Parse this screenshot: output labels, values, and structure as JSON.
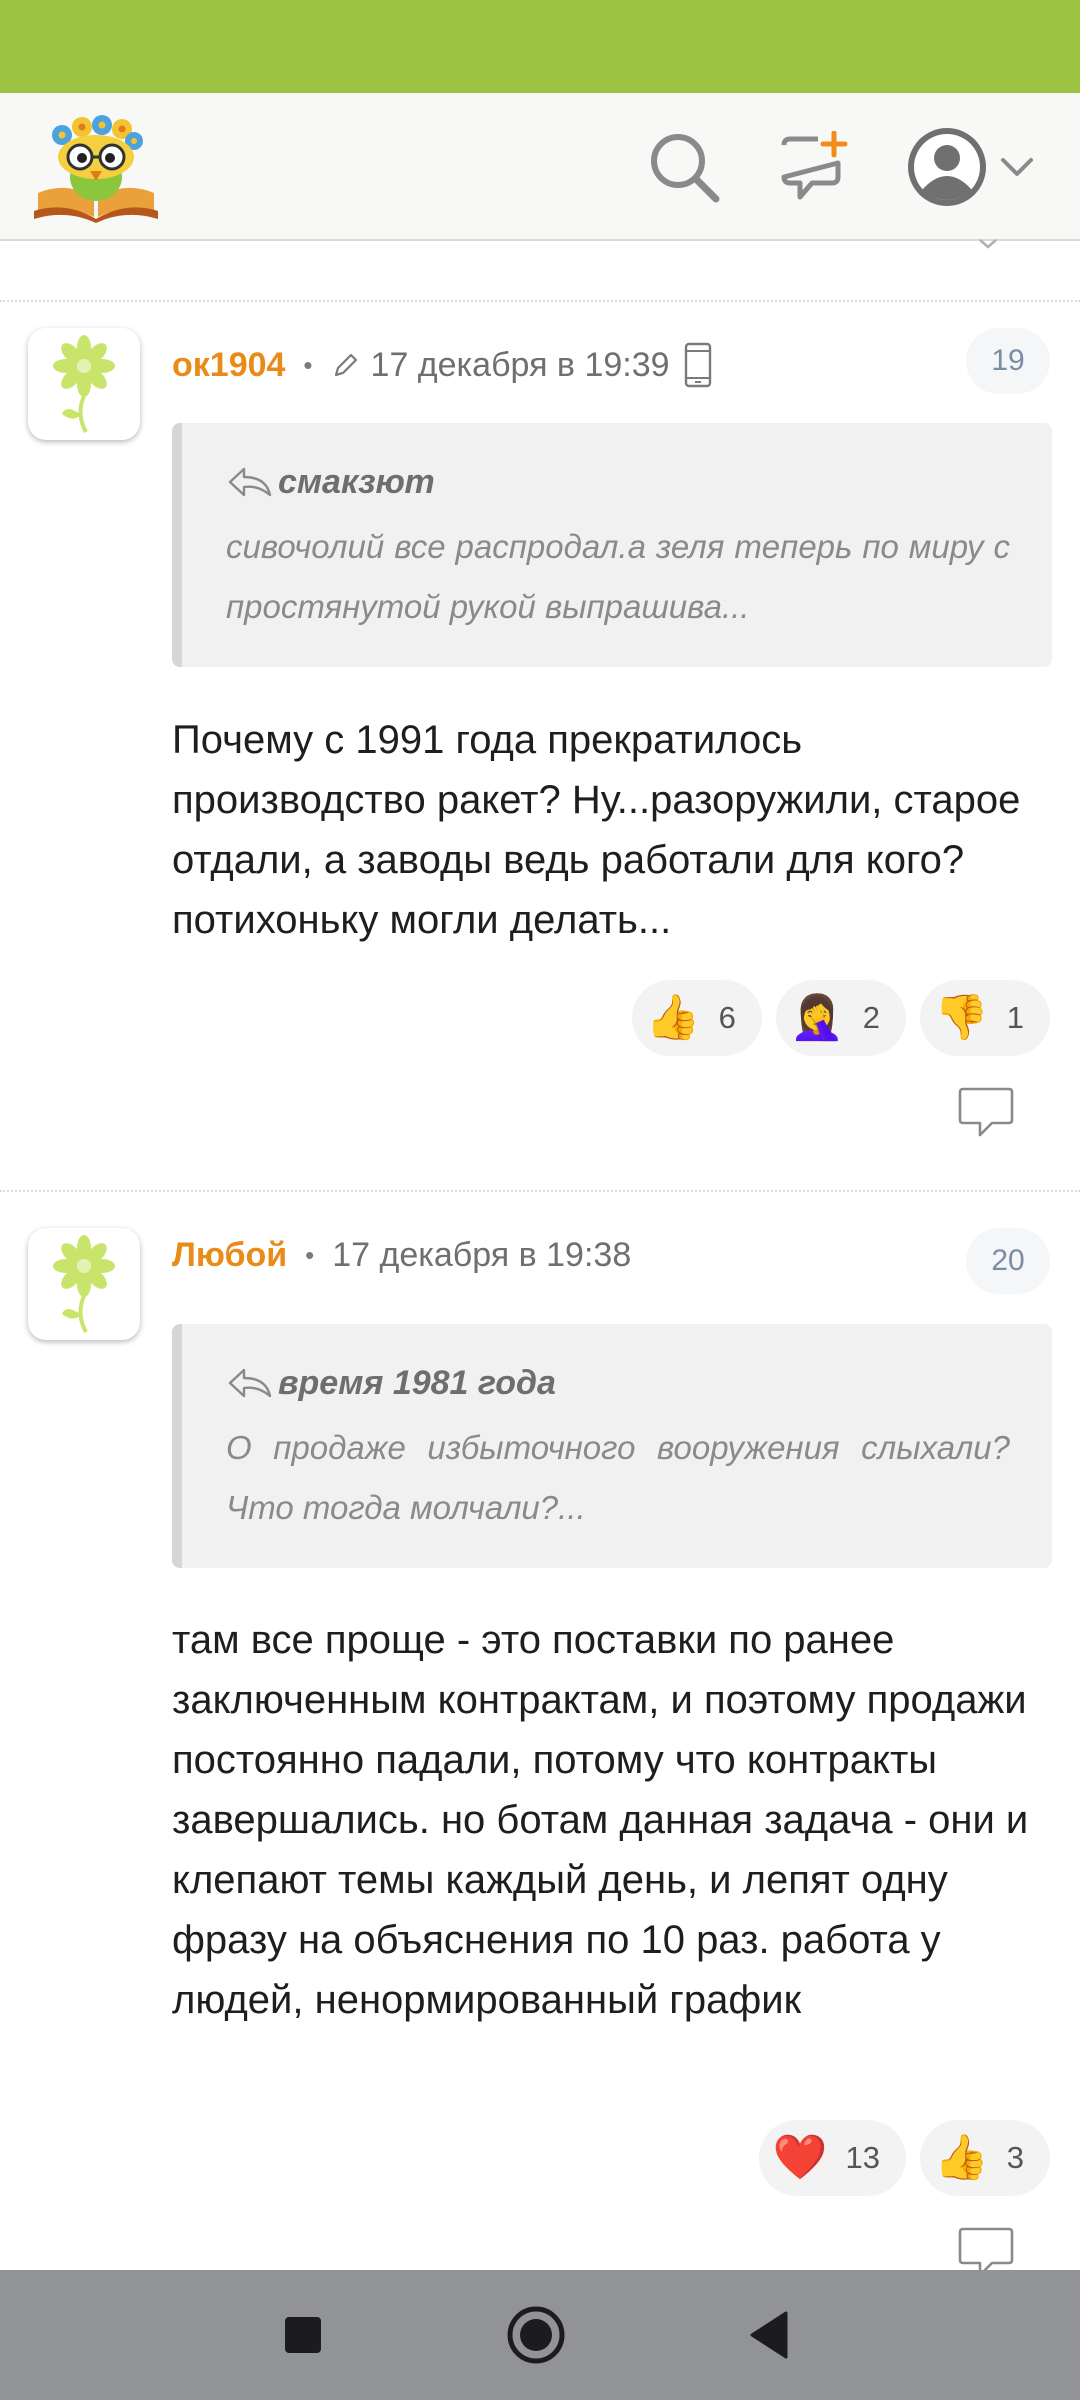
{
  "header": {
    "logo_icon": "flower-owl-book-logo",
    "search_icon": "search-icon",
    "new_post_icon": "new-post-icon",
    "user_icon": "user-avatar-icon",
    "menu_icon": "chevron-down-icon"
  },
  "colors": {
    "status_bar": "#9dc342",
    "author": "#e98a19",
    "badge_text": "#7a8ca6"
  },
  "comments": [
    {
      "author": "ок1904",
      "separator": "•",
      "date": "17 декабря в 19:39",
      "edited": true,
      "from_mobile": true,
      "number": "19",
      "quote": {
        "author": "смакзют",
        "text": "сивочолий все распродал.а зеля теперь по миру с простянутой рукой выпрашива..."
      },
      "text": "Почему с 1991 года прекратилось производство ракет? Ну...разоружили, старое отдали, а заводы ведь работали для кого? потихоньку могли делать...",
      "reactions": [
        {
          "emoji": "👍",
          "count": "6"
        },
        {
          "emoji": "🤦‍♀️",
          "count": "2"
        },
        {
          "emoji": "👎",
          "count": "1"
        }
      ]
    },
    {
      "author": "Любой",
      "separator": "•",
      "date": "17 декабря в 19:38",
      "edited": false,
      "from_mobile": false,
      "number": "20",
      "quote": {
        "author": "время 1981 года",
        "text": "О продаже избыточного вооружения слыхали? Что тогда молчали?..."
      },
      "text": "там все проще - это поставки по ранее заключенным контрактам, и поэтому продажи постоянно падали, потому что контракты завершались. но ботам данная задача - они и клепают темы каждый день, и лепят одну фразу на объяснения по 10 раз. работа у людей, ненормированный график",
      "reactions": [
        {
          "emoji": "❤️",
          "count": "13"
        },
        {
          "emoji": "👍",
          "count": "3"
        }
      ]
    }
  ],
  "navigation": {
    "recents_icon": "square-icon",
    "home_icon": "circle-home-icon",
    "back_icon": "triangle-back-icon"
  }
}
